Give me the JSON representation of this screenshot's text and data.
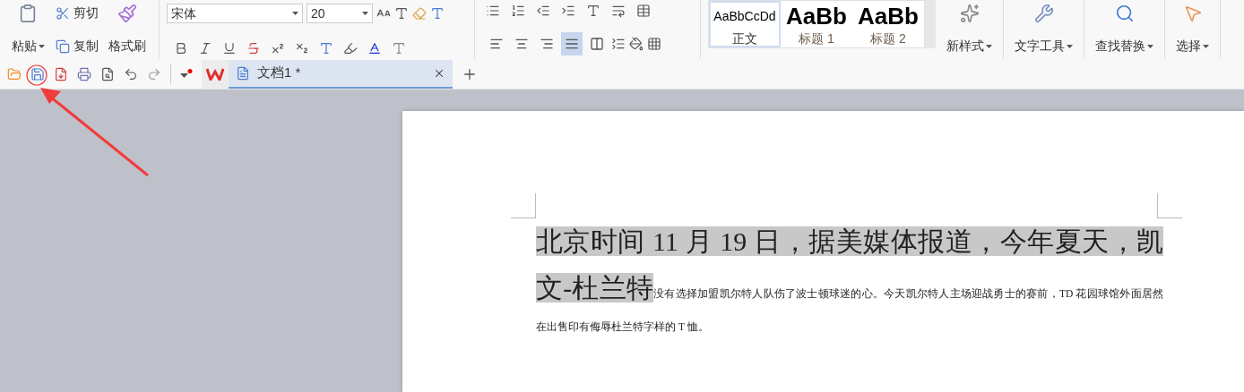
{
  "ribbon": {
    "clipboard": {
      "paste": "粘贴",
      "cut": "剪切",
      "copy": "复制",
      "format_painter": "格式刷"
    },
    "font": {
      "family": "宋体",
      "size": "20"
    },
    "paragraph": {
      "alignments": [
        {
          "kind": "left",
          "selected": false
        },
        {
          "kind": "center",
          "selected": false
        },
        {
          "kind": "right",
          "selected": false
        },
        {
          "kind": "justify",
          "selected": true
        },
        {
          "kind": "distributed",
          "selected": false
        }
      ]
    },
    "styles": [
      {
        "preview": "AaBbCcDd",
        "label": "正文",
        "kind": "body",
        "selected": true
      },
      {
        "preview": "AaBb",
        "label": "标题 1",
        "kind": "heading",
        "selected": false
      },
      {
        "preview": "AaBb",
        "label": "标题 2",
        "kind": "heading",
        "selected": false
      }
    ],
    "tools": [
      {
        "label": "新样式",
        "kind": "new-style"
      },
      {
        "label": "文字工具",
        "kind": "text-tools"
      },
      {
        "label": "查找替换",
        "kind": "find-replace"
      },
      {
        "label": "选择",
        "kind": "select"
      }
    ]
  },
  "tabs": [
    {
      "label": "文档1 *",
      "selected": true
    }
  ],
  "document": {
    "runs": [
      {
        "text": "北京时间 11 月 19 日，据美媒体报道，今年夏天，凯文-杜兰特",
        "kind": "large",
        "highlighted": true
      },
      {
        "text": "没有选择加盟凯尔特人队伤了波士顿球迷的心。今天凯尔特人主场迎战勇士的赛前，TD 花园球馆外面居然在出售印有侮辱杜兰特字样的 T 恤。",
        "kind": "small",
        "highlighted": false
      }
    ]
  }
}
